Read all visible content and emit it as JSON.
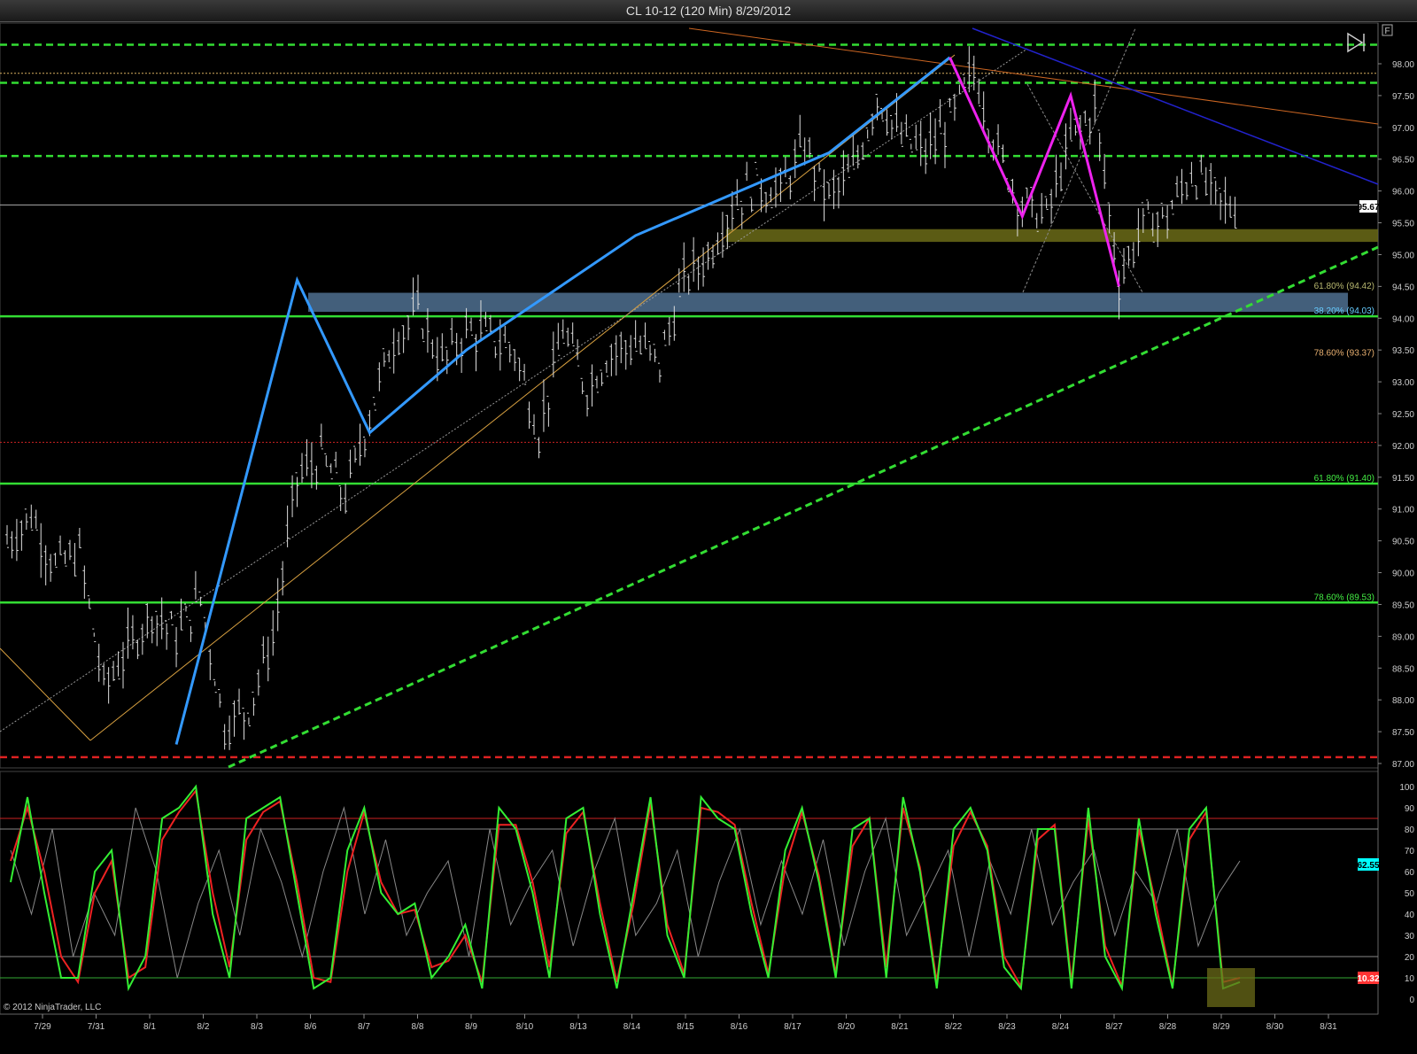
{
  "window": {
    "title": "CL 10-12 (120 Min)  8/29/2012"
  },
  "copyright": "© 2012 NinjaTrader, LLC",
  "nav_icons": [
    "jump-to-end-icon",
    "f-button-icon"
  ],
  "f_button_label": "F",
  "price_marker": {
    "value": "95.67",
    "color": "#ffffff"
  },
  "oscillator_marker_1": {
    "value": "62.55",
    "color": "#00ffff"
  },
  "oscillator_marker_2": {
    "value": "10.32",
    "color": "#ff3333"
  },
  "chart_data": [
    {
      "type": "line",
      "title": "",
      "xlabel": "",
      "ylabel": "",
      "x_tick_labels": [
        "7/29",
        "7/31",
        "8/1",
        "8/2",
        "8/3",
        "8/6",
        "8/7",
        "8/8",
        "8/9",
        "8/10",
        "8/13",
        "8/14",
        "8/15",
        "8/16",
        "8/17",
        "8/20",
        "8/21",
        "8/22",
        "8/23",
        "8/24",
        "8/27",
        "8/28",
        "8/29",
        "8/30",
        "8/31"
      ],
      "ylim": [
        87.0,
        98.3
      ],
      "y_tick_labels": [
        "98.00",
        "97.50",
        "97.00",
        "96.50",
        "96.00",
        "95.50",
        "95.00",
        "94.50",
        "94.00",
        "93.50",
        "93.00",
        "92.50",
        "92.00",
        "91.50",
        "91.00",
        "90.50",
        "90.00",
        "89.50",
        "89.00",
        "88.50",
        "88.00",
        "87.50",
        "87.00"
      ],
      "price_path": [
        [
          0,
          90.5
        ],
        [
          1,
          90.9
        ],
        [
          2,
          90.1
        ],
        [
          3,
          90.3
        ],
        [
          4,
          88.2
        ],
        [
          5,
          88.8
        ],
        [
          6,
          89.4
        ],
        [
          7,
          89.0
        ],
        [
          8,
          89.6
        ],
        [
          9,
          87.6
        ],
        [
          10,
          87.9
        ],
        [
          11,
          89.0
        ],
        [
          12,
          91.5
        ],
        [
          13,
          91.8
        ],
        [
          14,
          91.2
        ],
        [
          15,
          92.5
        ],
        [
          16,
          93.7
        ],
        [
          17,
          94.1
        ],
        [
          18,
          93.3
        ],
        [
          19,
          93.8
        ],
        [
          20,
          93.7
        ],
        [
          21,
          93.5
        ],
        [
          22,
          92.2
        ],
        [
          23,
          93.8
        ],
        [
          24,
          92.9
        ],
        [
          25,
          93.5
        ],
        [
          26,
          93.6
        ],
        [
          27,
          93.3
        ],
        [
          28,
          94.6
        ],
        [
          29,
          95.0
        ],
        [
          30,
          95.8
        ],
        [
          31,
          96.1
        ],
        [
          32,
          96.0
        ],
        [
          33,
          96.7
        ],
        [
          34,
          95.9
        ],
        [
          35,
          96.3
        ],
        [
          36,
          97.5
        ],
        [
          37,
          96.8
        ],
        [
          38,
          96.6
        ],
        [
          39,
          97.1
        ],
        [
          40,
          97.9
        ],
        [
          41,
          96.6
        ],
        [
          42,
          95.8
        ],
        [
          43,
          95.6
        ],
        [
          44,
          96.8
        ],
        [
          45,
          97.3
        ],
        [
          46,
          94.6
        ],
        [
          47,
          95.5
        ],
        [
          48,
          95.6
        ],
        [
          49,
          96.3
        ],
        [
          50,
          95.9
        ],
        [
          51,
          95.67
        ]
      ],
      "wave_blue": [
        [
          7,
          87.3
        ],
        [
          12,
          94.6
        ],
        [
          15,
          92.2
        ],
        [
          19,
          93.5
        ],
        [
          26,
          95.3
        ],
        [
          34,
          96.6
        ],
        [
          39,
          98.1
        ]
      ],
      "wave_magenta": [
        [
          39,
          98.1
        ],
        [
          42,
          95.6
        ],
        [
          44,
          97.5
        ],
        [
          46,
          94.5
        ]
      ],
      "levels": [
        {
          "label": "61.80% (94.42)",
          "value": 94.42,
          "color": "#b8b870"
        },
        {
          "label": "38.20% (94.03)",
          "value": 94.03,
          "color": "#66ccff"
        },
        {
          "label": "78.60% (93.37)",
          "value": 93.37,
          "color": "#e8b070"
        },
        {
          "label": "61.80% (91.40)",
          "value": 91.4,
          "color": "#44ee44"
        },
        {
          "label": "78.60% (89.53)",
          "value": 89.53,
          "color": "#44ee44"
        }
      ],
      "horizontal_lines": [
        {
          "value": 98.3,
          "style": "dashed",
          "color": "#33dd33"
        },
        {
          "value": 97.85,
          "style": "dotted",
          "color": "#d8b060"
        },
        {
          "value": 97.7,
          "style": "dashed",
          "color": "#33dd33"
        },
        {
          "value": 96.55,
          "style": "dashed",
          "color": "#33dd33"
        },
        {
          "value": 95.78,
          "style": "thin",
          "color": "#aaaaaa"
        },
        {
          "value": 94.03,
          "style": "solid",
          "color": "#33dd33"
        },
        {
          "value": 91.4,
          "style": "solid",
          "color": "#33dd33"
        },
        {
          "value": 89.53,
          "style": "solid",
          "color": "#33dd33"
        },
        {
          "value": 92.05,
          "style": "dotted",
          "color": "#cc2222"
        },
        {
          "value": 87.1,
          "style": "dashed",
          "color": "#dd2222"
        }
      ],
      "zones": [
        {
          "from": 95.2,
          "to": 95.4,
          "color": "#6b6b18"
        },
        {
          "from": 94.1,
          "to": 94.4,
          "color": "#4f7090"
        }
      ],
      "grid": false,
      "legend": "none"
    },
    {
      "type": "line",
      "title": "",
      "ylim": [
        0,
        100
      ],
      "y_tick_labels": [
        "100",
        "90",
        "80",
        "70",
        "60",
        "50",
        "40",
        "30",
        "20",
        "10",
        "0"
      ],
      "reference_lines": [
        {
          "value": 85,
          "color": "#cc2222"
        },
        {
          "value": 80,
          "color": "#888888"
        },
        {
          "value": 20,
          "color": "#888888"
        },
        {
          "value": 10,
          "color": "#33aa33"
        }
      ],
      "series": [
        {
          "color": "#33ee33",
          "values": [
            55,
            95,
            50,
            10,
            10,
            60,
            70,
            5,
            20,
            85,
            90,
            100,
            40,
            10,
            85,
            90,
            95,
            50,
            5,
            10,
            70,
            90,
            50,
            40,
            45,
            10,
            20,
            35,
            5,
            90,
            80,
            50,
            10,
            85,
            90,
            40,
            5,
            50,
            95,
            30,
            10,
            95,
            85,
            80,
            40,
            10,
            70,
            90,
            55,
            10,
            80,
            85,
            10,
            95,
            60,
            5,
            80,
            90,
            70,
            15,
            5,
            80,
            80,
            5,
            90,
            20,
            5,
            85,
            40,
            5,
            80,
            90,
            5,
            8
          ]
        },
        {
          "color": "#ee2222",
          "values": [
            65,
            90,
            60,
            20,
            8,
            50,
            65,
            10,
            15,
            75,
            88,
            98,
            50,
            15,
            75,
            88,
            93,
            55,
            10,
            8,
            60,
            88,
            55,
            40,
            42,
            15,
            18,
            30,
            8,
            82,
            82,
            55,
            15,
            78,
            88,
            45,
            8,
            45,
            92,
            35,
            12,
            90,
            88,
            82,
            45,
            12,
            62,
            88,
            58,
            12,
            72,
            85,
            15,
            90,
            62,
            8,
            72,
            88,
            72,
            20,
            6,
            75,
            82,
            8,
            85,
            25,
            6,
            80,
            45,
            6,
            75,
            88,
            8,
            10
          ]
        },
        {
          "color": "#888888",
          "values": [
            70,
            40,
            80,
            20,
            50,
            30,
            90,
            60,
            10,
            45,
            70,
            30,
            80,
            55,
            20,
            60,
            90,
            40,
            75,
            30,
            50,
            65,
            20,
            80,
            35,
            55,
            70,
            25,
            60,
            85,
            30,
            45,
            70,
            20,
            55,
            80,
            35,
            65,
            40,
            75,
            25,
            60,
            85,
            30,
            50,
            70,
            20,
            65,
            40,
            80,
            35,
            55,
            70,
            30,
            60,
            45,
            80,
            25,
            50,
            65
          ]
        }
      ]
    }
  ]
}
